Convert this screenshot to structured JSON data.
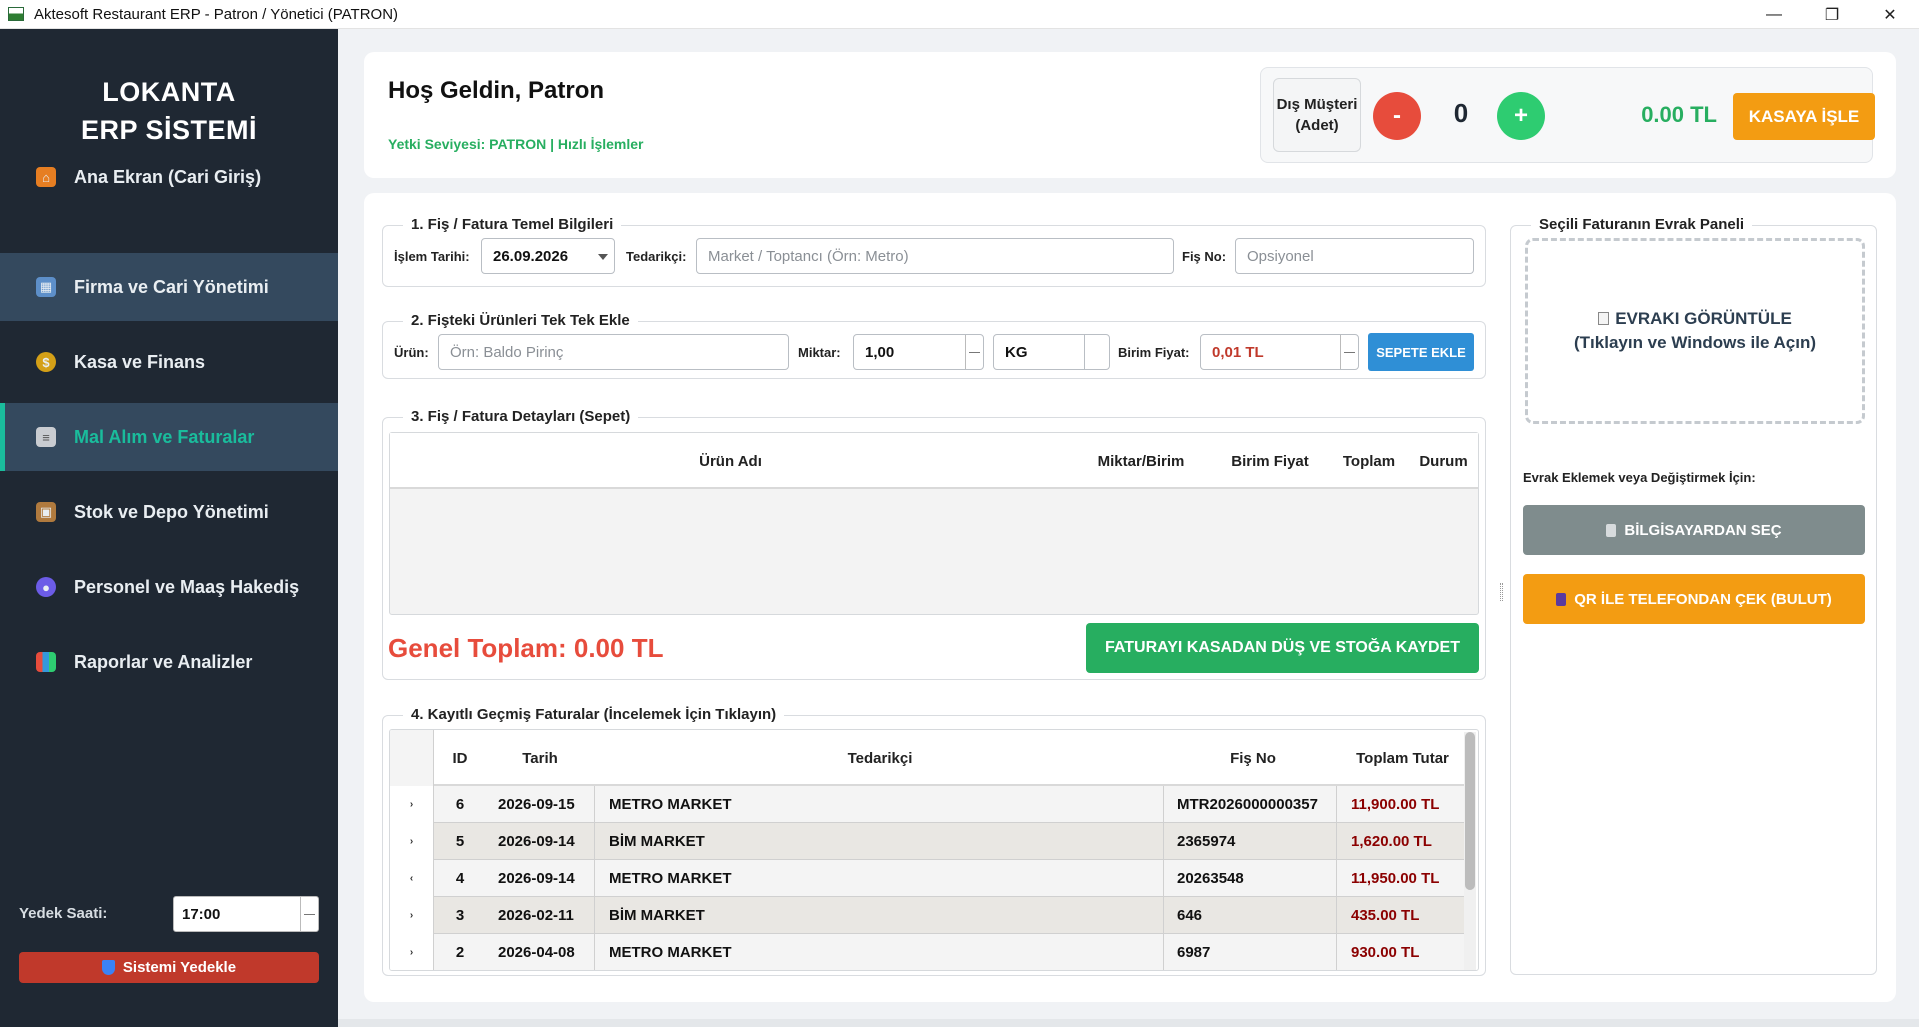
{
  "window": {
    "title": "Aktesoft Restaurant ERP - Patron / Yönetici (PATRON)",
    "minimize": "—",
    "maximize": "❐",
    "close": "✕"
  },
  "sidebar": {
    "brand_line1": "LOKANTA",
    "brand_line2": "ERP SİSTEMİ",
    "items": [
      {
        "label": "Ana Ekran (Cari Giriş)",
        "icon": "house-icon"
      },
      {
        "label": "Firma ve Cari Yönetimi",
        "icon": "office-building-icon"
      },
      {
        "label": "Kasa ve Finans",
        "icon": "money-bag-icon"
      },
      {
        "label": "Mal Alım ve Faturalar",
        "icon": "receipt-icon"
      },
      {
        "label": "Stok ve Depo Yönetimi",
        "icon": "package-icon"
      },
      {
        "label": "Personel ve Maaş Hakediş",
        "icon": "people-icon"
      },
      {
        "label": "Raporlar ve Analizler",
        "icon": "bar-chart-icon"
      }
    ],
    "backup_label": "Yedek Saati:",
    "backup_time": "17:00",
    "backup_button": "Sistemi Yedekle"
  },
  "header": {
    "welcome": "Hoş Geldin, Patron",
    "role": "Yetki Seviyesi: PATRON | Hızlı İşlemler",
    "guest_label_1": "Dış Müşteri",
    "guest_label_2": "(Adet)",
    "minus": "-",
    "plus": "+",
    "count": "0",
    "amount": "0.00 TL",
    "kasa_button": "KASAYA İŞLE"
  },
  "section1": {
    "title": "1. Fiş / Fatura Temel Bilgileri",
    "date_label": "İşlem Tarihi:",
    "date_value": "26.09.2026",
    "supplier_label": "Tedarikçi:",
    "supplier_placeholder": "Market / Toptancı (Örn: Metro)",
    "receipt_label": "Fiş No:",
    "receipt_placeholder": "Opsiyonel"
  },
  "section2": {
    "title": "2. Fişteki Ürünleri Tek Tek Ekle",
    "product_label": "Ürün:",
    "product_placeholder": "Örn: Baldo Pirinç",
    "qty_label": "Miktar:",
    "qty_value": "1,00",
    "unit_value": "KG",
    "price_label": "Birim Fiyat:",
    "price_value": "0,01 TL",
    "add_button": "SEPETE EKLE"
  },
  "section3": {
    "title": "3. Fiş / Fatura Detayları (Sepet)",
    "columns": [
      "Ürün Adı",
      "Miktar/Birim",
      "Birim Fiyat",
      "Toplam",
      "Durum"
    ],
    "grand_total": "Genel Toplam: 0.00 TL",
    "save_button": "FATURAYI KASADAN DÜŞ VE STOĞA KAYDET"
  },
  "section4": {
    "title": "4. Kayıtlı Geçmiş Faturalar (İncelemek İçin Tıklayın)",
    "columns": [
      "ID",
      "Tarih",
      "Tedarikçi",
      "Fiş No",
      "Toplam Tutar"
    ],
    "rows": [
      {
        "mark": "›",
        "id": "6",
        "date": "2026-09-15",
        "supplier": "METRO MARKET",
        "receipt": "MTR2026000000357",
        "total": "11,900.00 TL"
      },
      {
        "mark": "›",
        "id": "5",
        "date": "2026-09-14",
        "supplier": "BİM MARKET",
        "receipt": "2365974",
        "total": "1,620.00 TL"
      },
      {
        "mark": "‹",
        "id": "4",
        "date": "2026-09-14",
        "supplier": "METRO MARKET",
        "receipt": "20263548",
        "total": "11,950.00 TL"
      },
      {
        "mark": "›",
        "id": "3",
        "date": "2026-02-11",
        "supplier": "BİM MARKET",
        "receipt": "646",
        "total": "435.00 TL"
      },
      {
        "mark": "›",
        "id": "2",
        "date": "2026-04-08",
        "supplier": "METRO MARKET",
        "receipt": "6987",
        "total": "930.00 TL"
      }
    ]
  },
  "doc_panel": {
    "title": "Seçili Faturanın Evrak Paneli",
    "view_line1": "EVRAKI GÖRÜNTÜLE",
    "view_line2": "(Tıklayın ve Windows ile Açın)",
    "note": "Evrak Eklemek veya Değiştirmek İçin:",
    "pc_button": "BİLGİSAYARDAN SEÇ",
    "qr_button": "QR İLE TELEFONDAN ÇEK (BULUT)"
  },
  "colors": {
    "sidebar_bg": "#1f2833",
    "accent": "#1abc9c",
    "success": "#27ae60",
    "danger": "#e74c3c",
    "warning": "#f39c12"
  }
}
